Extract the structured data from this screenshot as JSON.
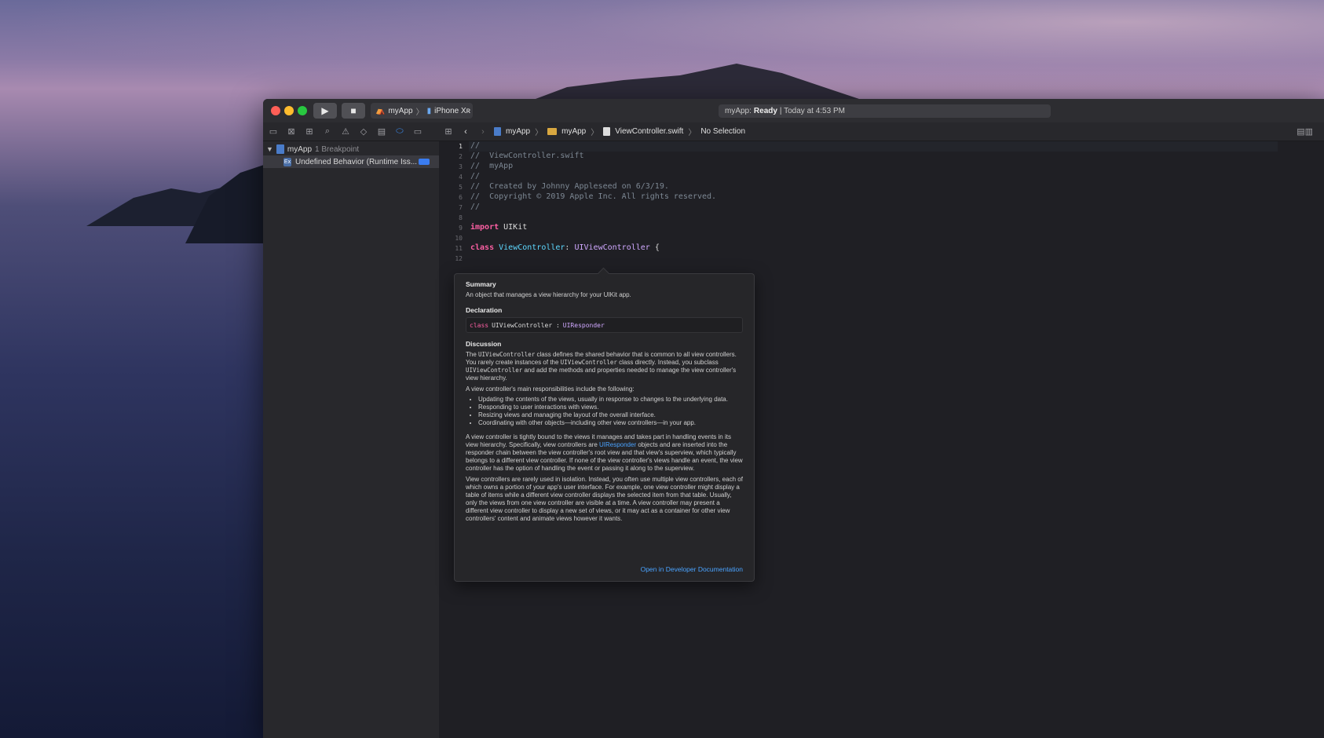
{
  "window": {
    "scheme_app": "myApp",
    "scheme_device": "iPhone Xʀ",
    "activity_prefix": "myApp:",
    "activity_status": "Ready",
    "activity_time": "| Today at 4:53 PM"
  },
  "navigator": {
    "project_name": "myApp",
    "project_detail": "1 Breakpoint",
    "breakpoint_label": "Undefined Behavior (Runtime Iss..."
  },
  "jumpbar": {
    "crumb_project": "myApp",
    "crumb_group": "myApp",
    "crumb_file": "ViewController.swift",
    "crumb_selection": "No Selection"
  },
  "code_lines": {
    "l1": "//",
    "l2": "//  ViewController.swift",
    "l3": "//  myApp",
    "l4": "//",
    "l5": "//  Created by Johnny Appleseed on 6/3/19.",
    "l6": "//  Copyright © 2019 Apple Inc. All rights reserved.",
    "l7": "//",
    "l9_kw": "import",
    "l9_rest": " UIKit",
    "l11_kw": "class",
    "l11_name": " ViewController",
    "l11_colon": ": ",
    "l11_super": "UIViewController",
    "l11_brace": " {",
    "line_numbers": [
      "1",
      "2",
      "3",
      "4",
      "5",
      "6",
      "7",
      "8",
      "9",
      "10",
      "11",
      "12"
    ]
  },
  "quick_help": {
    "summary_heading": "Summary",
    "summary_text": "An object that manages a view hierarchy for your UIKit app.",
    "declaration_heading": "Declaration",
    "decl_kw": "class",
    "decl_name": "UIViewController :",
    "decl_super": "UIResponder",
    "discussion_heading": "Discussion",
    "d1_a": "The ",
    "d1_code1": "UIViewController",
    "d1_b": " class defines the shared behavior that is common to all view controllers. You rarely create instances of the ",
    "d1_code2": "UIViewController",
    "d1_c": " class directly. Instead, you subclass ",
    "d1_code3": "UIViewController",
    "d1_d": " and add the methods and properties needed to manage the view controller's view hierarchy.",
    "d2": "A view controller's main responsibilities include the following:",
    "bullets": [
      "Updating the contents of the views, usually in response to changes to the underlying data.",
      "Responding to user interactions with views.",
      "Resizing views and managing the layout of the overall interface.",
      "Coordinating with other objects—including other view controllers—in your app."
    ],
    "d3_a": "A view controller is tightly bound to the views it manages and takes part in handling events in its view hierarchy. Specifically, view controllers are ",
    "d3_link": "UIResponder",
    "d3_b": " objects and are inserted into the responder chain between the view controller's root view and that view's superview, which typically belongs to a different view controller. If none of the view controller's views handle an event, the view controller has the option of handling the event or passing it along to the superview.",
    "d4": "View controllers are rarely used in isolation. Instead, you often use multiple view controllers, each of which owns a portion of your app's user interface. For example, one view controller might display a table of items while a different view controller displays the selected item from that table. Usually, only the views from one view controller are visible at a time. A view controller may present a different view controller to display a new set of views, or it may act as a container for other view controllers' content and animate views however it wants.",
    "doc_link": "Open in Developer Documentation"
  }
}
